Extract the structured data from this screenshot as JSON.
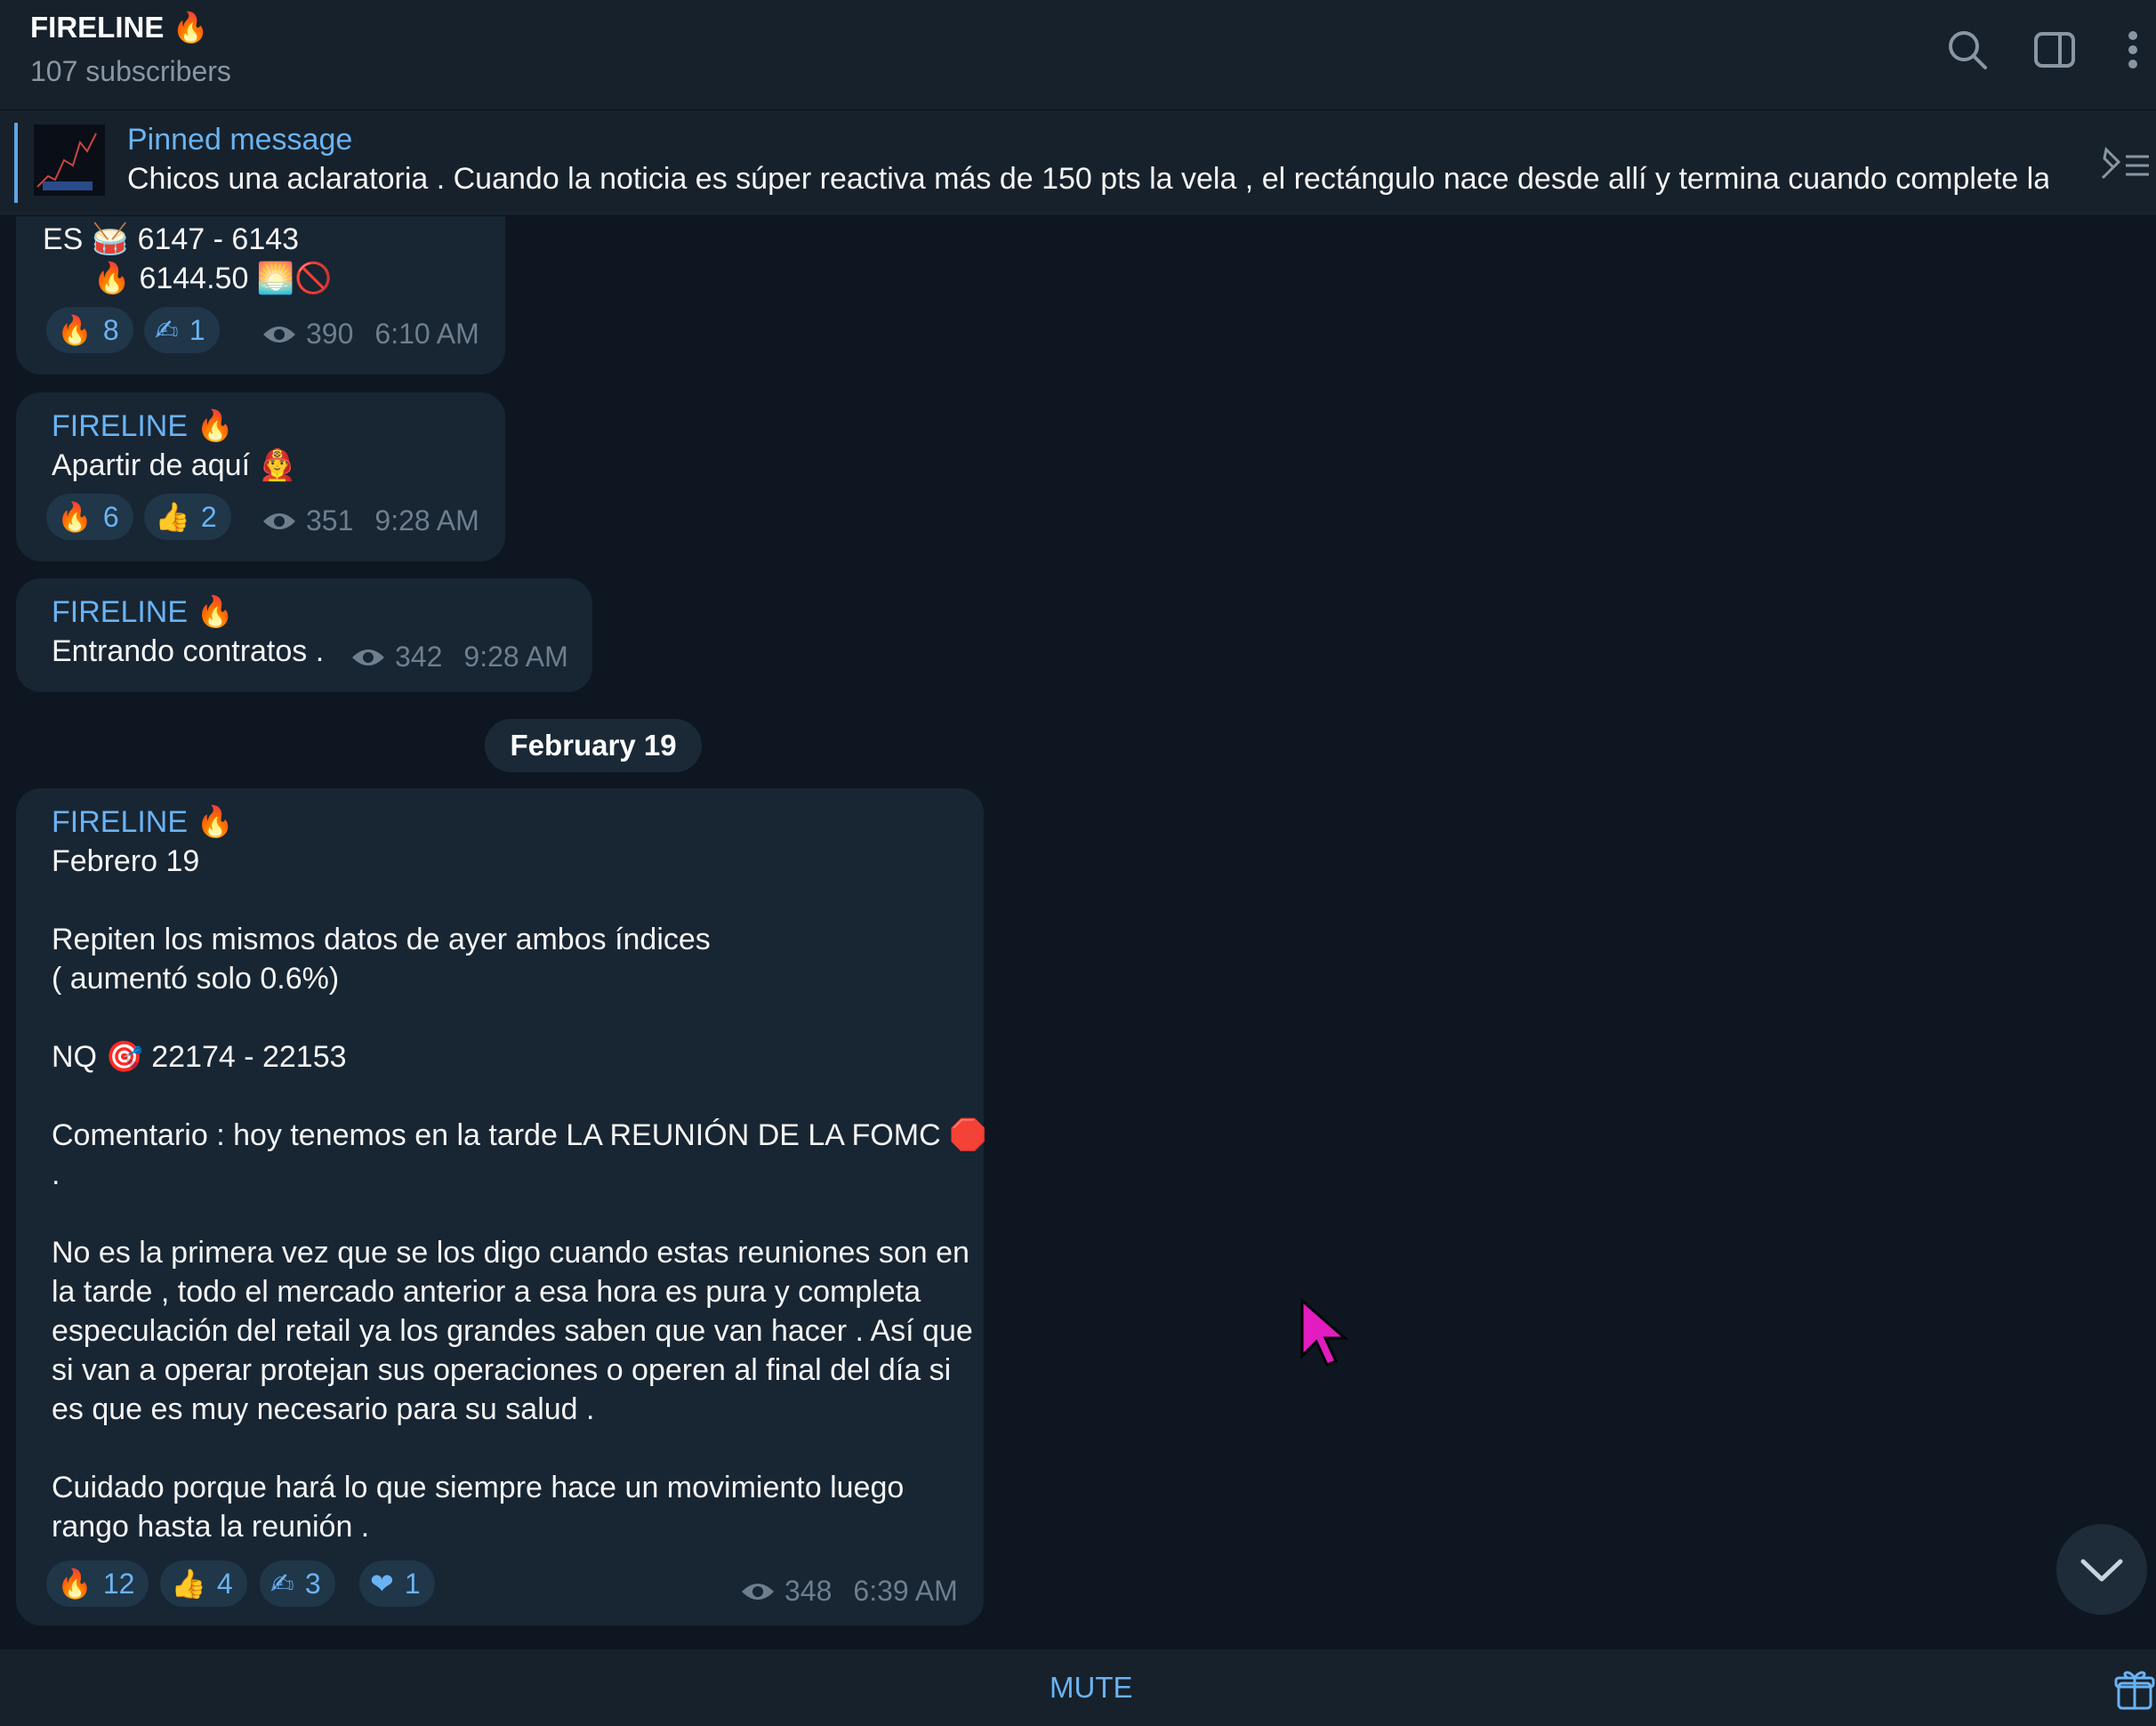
{
  "header": {
    "title": "FIRELINE 🔥",
    "subscribers": "107 subscribers",
    "icons": [
      "search-icon",
      "sidebar-toggle-icon",
      "more-vertical-icon"
    ]
  },
  "pinned": {
    "label": "Pinned message",
    "text": "Chicos una aclaratoria .  Cuando la noticia es súper reactiva más de 150 pts la vela , el rectángulo nace desde allí y termina cuando complete las...",
    "icon": "pinned-list-icon"
  },
  "messages": [
    {
      "sender": "",
      "lines": [
        "ES 🥁 6147 - 6143",
        "      🔥 6144.50 🌅🚫"
      ],
      "reactions": [
        {
          "emoji": "🔥",
          "count": "8"
        },
        {
          "emoji": "✍",
          "count": "1"
        }
      ],
      "views": "390",
      "time": "6:10 AM"
    },
    {
      "sender": "FIRELINE 🔥",
      "lines": [
        "Apartir de aquí 👨‍🚒"
      ],
      "reactions": [
        {
          "emoji": "🔥",
          "count": "6"
        },
        {
          "emoji": "👍",
          "count": "2"
        }
      ],
      "views": "351",
      "time": "9:28 AM"
    },
    {
      "sender": "FIRELINE 🔥",
      "lines": [
        "Entrando contratos ."
      ],
      "reactions": [],
      "views": "342",
      "time": "9:28 AM"
    },
    {
      "sender": "FIRELINE 🔥",
      "lines": [
        "Febrero 19",
        "",
        "Repiten los mismos datos de ayer ambos índices",
        "( aumentó solo 0.6%)",
        "",
        "NQ 🎯 22174 - 22153",
        "",
        "Comentario : hoy tenemos en la tarde LA REUNIÓN DE LA FOMC 🛑",
        ".",
        "",
        "No es la primera vez que se los digo cuando estas reuniones son en",
        "la tarde , todo el mercado anterior a esa hora es pura y completa",
        "especulación del retail ya los grandes saben que van hacer . Así que",
        "si van a operar protejan sus operaciones o operen al final del día si",
        "es que es muy necesario para su salud .",
        "",
        "Cuidado porque hará lo que siempre hace un movimiento luego",
        "rango hasta la reunión ."
      ],
      "reactions": [
        {
          "emoji": "🔥",
          "count": "12"
        },
        {
          "emoji": "👍",
          "count": "4"
        },
        {
          "emoji": "✍",
          "count": "3"
        },
        {
          "emoji": "❤",
          "count": "1"
        }
      ],
      "views": "348",
      "time": "6:39 AM"
    }
  ],
  "date_separator": "February 19",
  "footer": {
    "mute_label": "MUTE",
    "gift_icon": "gift-icon"
  },
  "colors": {
    "background": "#0e1621",
    "panel": "#17212b",
    "bubble": "#182533",
    "accent": "#6ab3f3",
    "muted": "#6d7f8f"
  }
}
